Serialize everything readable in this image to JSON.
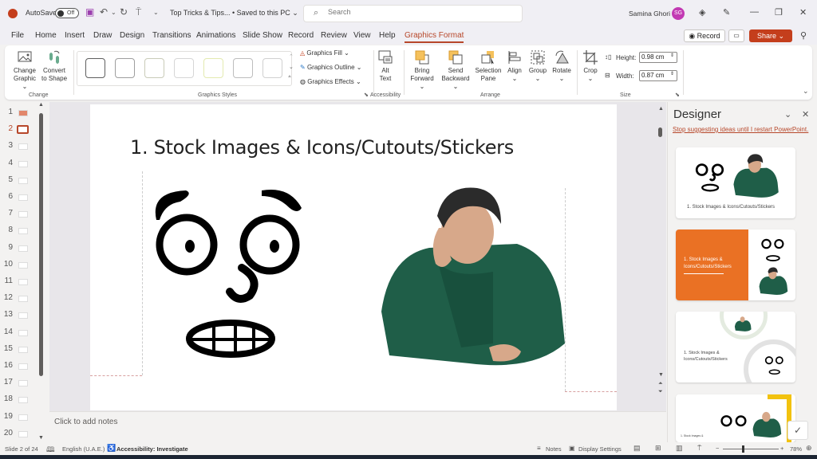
{
  "titlebar": {
    "autosave_label": "AutoSave",
    "autosave_state": "Off",
    "doc_title": "Top Tricks & Tips... • Saved to this PC ⌄",
    "search_placeholder": "Search",
    "user_name": "Samina Ghori",
    "user_initials": "SG",
    "icons": [
      "save-icon",
      "undo-icon",
      "redo-icon",
      "present-icon",
      "customize-icon",
      "diamond-icon",
      "pen-icon",
      "minimize-icon",
      "restore-icon",
      "close-icon"
    ]
  },
  "tabs": [
    {
      "label": "File"
    },
    {
      "label": "Home"
    },
    {
      "label": "Insert"
    },
    {
      "label": "Draw"
    },
    {
      "label": "Design"
    },
    {
      "label": "Transitions"
    },
    {
      "label": "Animations"
    },
    {
      "label": "Slide Show"
    },
    {
      "label": "Record"
    },
    {
      "label": "Review"
    },
    {
      "label": "View"
    },
    {
      "label": "Help"
    },
    {
      "label": "Graphics Format",
      "active": true
    }
  ],
  "tab_actions": {
    "record": "◉ Record",
    "share": "Share"
  },
  "ribbon": {
    "change": {
      "label": "Change",
      "change_graphic": "Change Graphic ⌄",
      "convert": "Convert to Shape"
    },
    "styles": {
      "label": "Graphics Styles",
      "fill": "Graphics Fill ⌄",
      "outline": "Graphics Outline ⌄",
      "effects": "Graphics Effects ⌄",
      "swatches": [
        "#5f5f5f",
        "#9e9e9e",
        "#c9cbb8",
        "#c8c8c8",
        "#e3eab0",
        "#bdbdbd",
        "#d0d0d0"
      ]
    },
    "accessibility": {
      "label": "Accessibility",
      "alt_text": "Alt Text"
    },
    "arrange": {
      "label": "Arrange",
      "bring_forward": "Bring Forward ⌄",
      "send_backward": "Send Backward ⌄",
      "selection_pane": "Selection Pane",
      "align": "Align ⌄",
      "group": "Group ⌄",
      "rotate": "Rotate ⌄"
    },
    "size": {
      "label": "Size",
      "crop": "Crop ⌄",
      "height_label": "Height:",
      "height_value": "0.98 cm",
      "width_label": "Width:",
      "width_value": "0.87 cm"
    }
  },
  "thumbnails": {
    "numbers": [
      "1",
      "2",
      "3",
      "4",
      "5",
      "6",
      "7",
      "8",
      "9",
      "10",
      "11",
      "12",
      "13",
      "14",
      "15",
      "16",
      "17",
      "18",
      "19",
      "20"
    ],
    "active": "2"
  },
  "slide": {
    "title": "1. Stock Images & Icons/Cutouts/Stickers"
  },
  "notes_placeholder": "Click to add notes",
  "designer": {
    "title": "Designer",
    "stop_link": "Stop suggesting ideas until I restart PowerPoint.",
    "cards": [
      {
        "caption": "1. Stock Images & Icons/Cutouts/Stickers"
      },
      {
        "caption": "1. Stock Images & Icons/Cutouts/Stickers",
        "accent": "#ea7124"
      },
      {
        "caption": "1. Stock Images & Icons/Cutouts/Stickers"
      },
      {
        "caption": "1. Stock Images &",
        "accent": "#f2c20f"
      }
    ]
  },
  "statusbar": {
    "slide_info": "Slide 2 of 24",
    "language": "English (U.A.E.)",
    "accessibility": "Accessibility: Investigate",
    "notes": "Notes",
    "display_settings": "Display Settings",
    "zoom": "78%"
  }
}
